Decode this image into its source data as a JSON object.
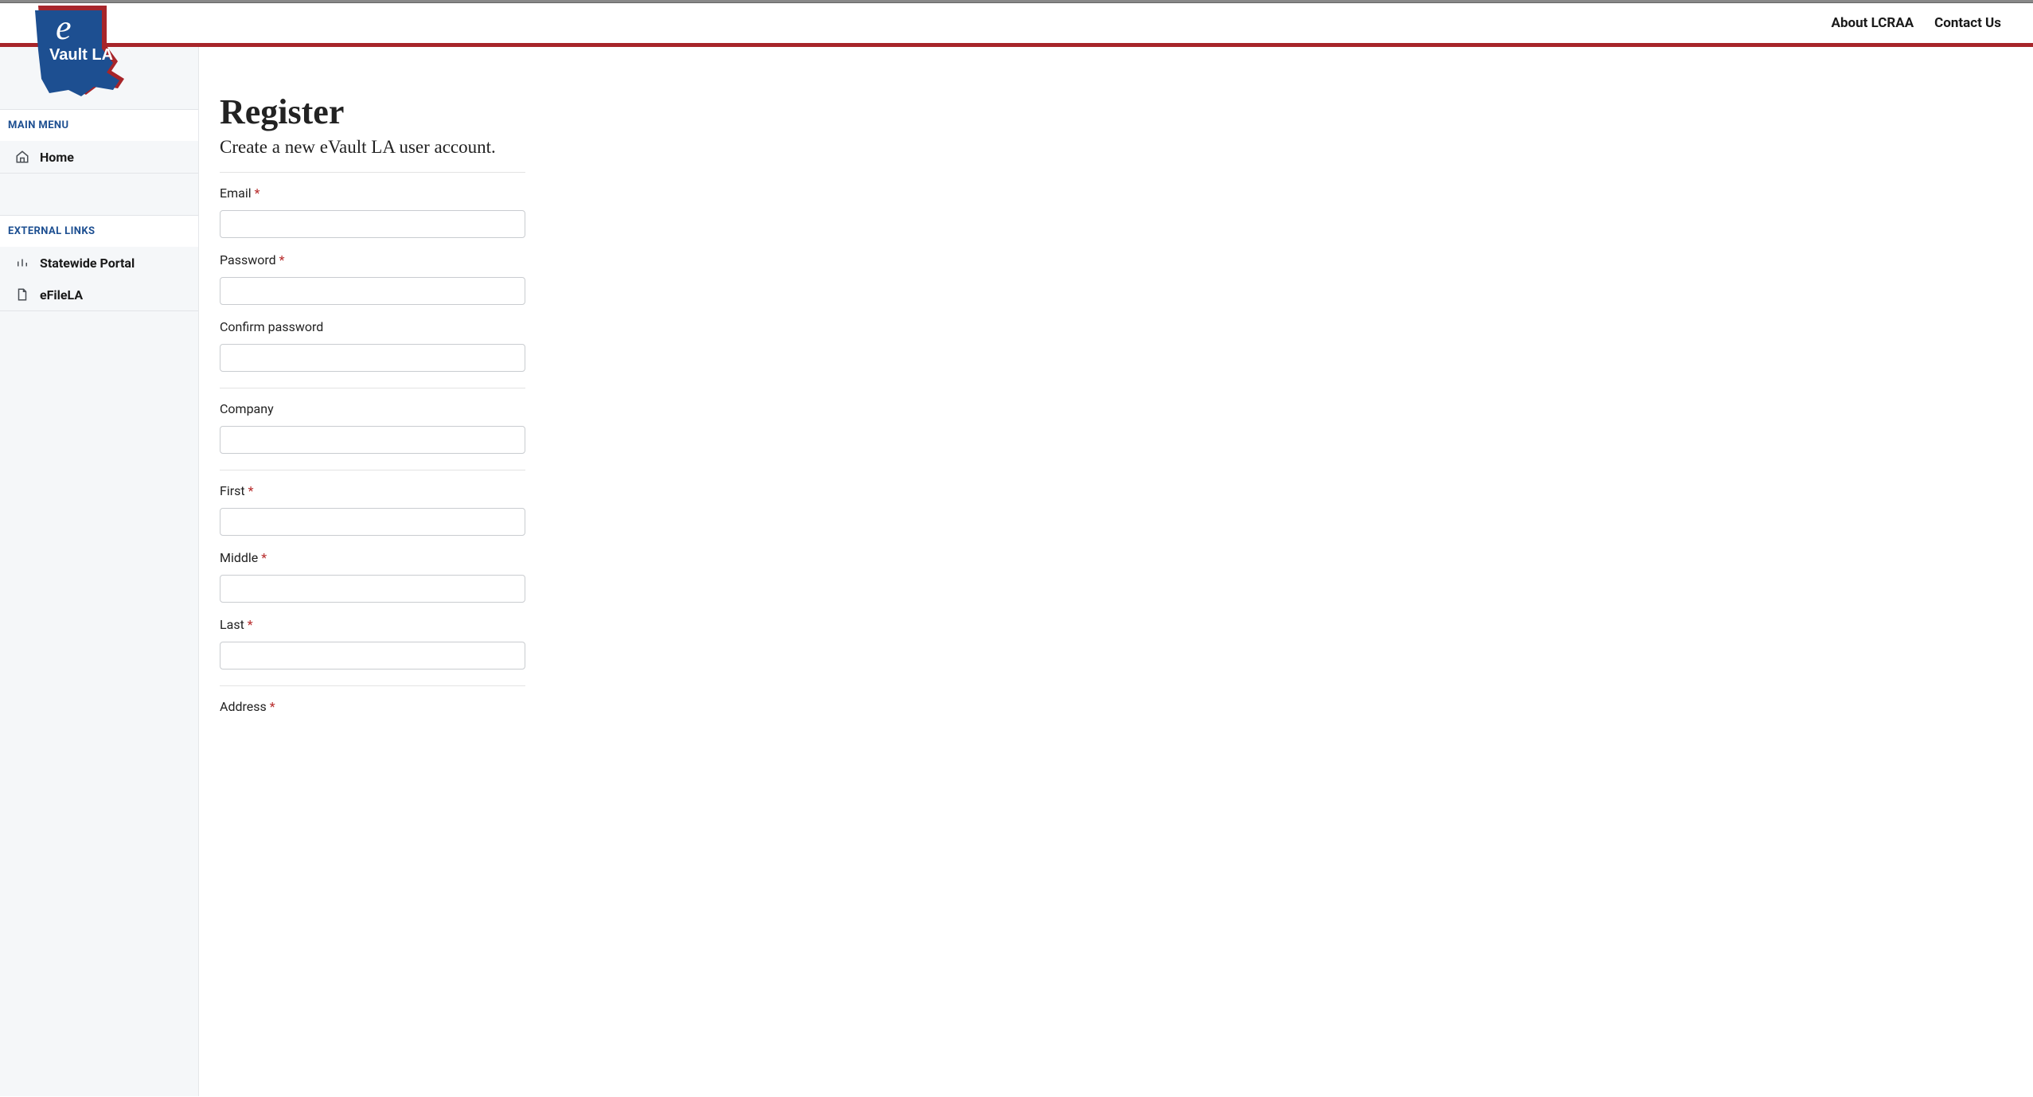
{
  "header": {
    "links": [
      {
        "label": "About LCRAA"
      },
      {
        "label": "Contact Us"
      }
    ]
  },
  "logo": {
    "text_line1": "e",
    "text_line2": "Vault LA"
  },
  "sidebar": {
    "sections": [
      {
        "header": "MAIN MENU",
        "items": [
          {
            "label": "Home",
            "icon": "home-icon"
          }
        ]
      },
      {
        "header": "EXTERNAL LINKS",
        "items": [
          {
            "label": "Statewide Portal",
            "icon": "bars-icon"
          },
          {
            "label": "eFileLA",
            "icon": "file-icon"
          }
        ]
      }
    ]
  },
  "page": {
    "title": "Register",
    "subtitle": "Create a new eVault LA user account."
  },
  "form": {
    "fields": [
      {
        "label": "Email",
        "required": true,
        "value": "",
        "separator_after": false
      },
      {
        "label": "Password",
        "required": true,
        "value": "",
        "separator_after": false
      },
      {
        "label": "Confirm password",
        "required": false,
        "value": "",
        "separator_after": true
      },
      {
        "label": "Company",
        "required": false,
        "value": "",
        "separator_after": true
      },
      {
        "label": "First",
        "required": true,
        "value": "",
        "separator_after": false
      },
      {
        "label": "Middle",
        "required": true,
        "value": "",
        "separator_after": false
      },
      {
        "label": "Last",
        "required": true,
        "value": "",
        "separator_after": true
      },
      {
        "label": "Address",
        "required": true,
        "value": "",
        "separator_after": false
      }
    ]
  }
}
